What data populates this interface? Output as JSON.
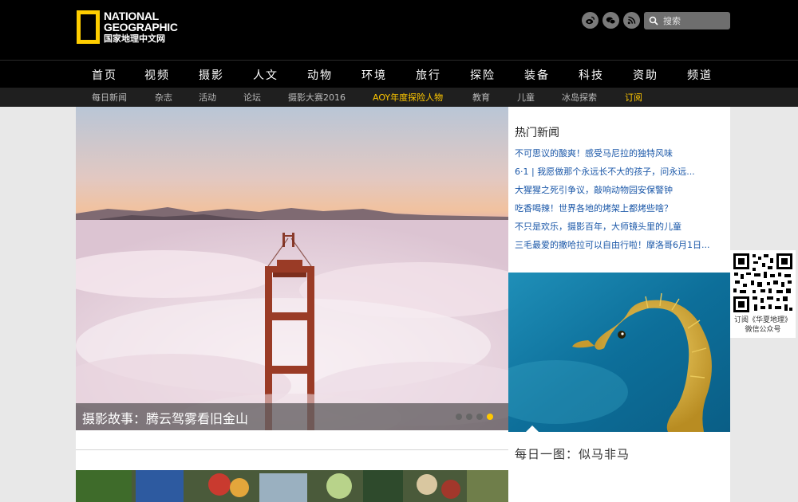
{
  "header": {
    "logo": {
      "line1": "NATIONAL",
      "line2": "GEOGRAPHIC",
      "line3": "国家地理中文网"
    },
    "social": [
      "weibo-icon",
      "wechat-icon",
      "rss-icon"
    ],
    "search": {
      "placeholder": "搜索"
    }
  },
  "main_nav": [
    "首页",
    "视频",
    "摄影",
    "人文",
    "动物",
    "环境",
    "旅行",
    "探险",
    "装备",
    "科技",
    "资助",
    "频道"
  ],
  "sub_nav": [
    {
      "label": "每日新闻",
      "highlight": false
    },
    {
      "label": "杂志",
      "highlight": false
    },
    {
      "label": "活动",
      "highlight": false
    },
    {
      "label": "论坛",
      "highlight": false
    },
    {
      "label": "摄影大赛2016",
      "highlight": false
    },
    {
      "label": "AOY年度探险人物",
      "highlight": true
    },
    {
      "label": "教育",
      "highlight": false
    },
    {
      "label": "儿童",
      "highlight": false
    },
    {
      "label": "冰岛探索",
      "highlight": false
    },
    {
      "label": "订阅",
      "highlight": true
    }
  ],
  "hero": {
    "caption": "摄影故事：腾云驾雾看旧金山",
    "slide_count": 4,
    "active_slide": 4
  },
  "sidebar": {
    "hot_title": "热门新闻",
    "hot_news": [
      "不可思议的酸爽！感受马尼拉的独特风味",
      "6·1 | 我愿做那个永远长不大的孩子，问永远...",
      "大猩猩之死引争议，敲响动物园安保警钟",
      "吃香喝辣！世界各地的烤架上都烤些啥？",
      "不只是欢乐，摄影百年，大师镜头里的儿童",
      "三毛最爱的撒哈拉可以自由行啦！摩洛哥6月1日..."
    ],
    "daily_title": "每日一图：似马非马"
  },
  "qr": {
    "label1": "订阅《华夏地理》",
    "label2": "微信公众号"
  },
  "colors": {
    "accent": "#ffc800",
    "link": "#1a57a8",
    "logo_yellow": "#ffce00"
  }
}
